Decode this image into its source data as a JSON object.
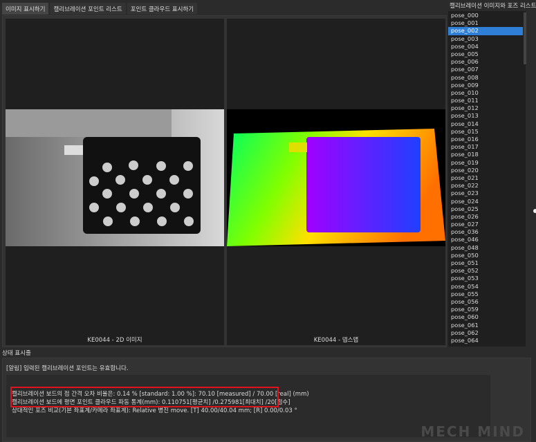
{
  "tabs": [
    "이미지 표시하기",
    "캘리브레이션 포인트 리스트",
    "포인트 클라우드 표시하기"
  ],
  "panels": {
    "left_caption": "KE0044 - 2D 이미지",
    "right_caption": "KE0044 - 뎁스맵"
  },
  "pose_list": {
    "title": "캘리브레이션 이미지와 포즈 리스트",
    "selected": "pose_002",
    "items": [
      "pose_000",
      "pose_001",
      "pose_002",
      "pose_003",
      "pose_004",
      "pose_005",
      "pose_006",
      "pose_007",
      "pose_008",
      "pose_009",
      "pose_010",
      "pose_011",
      "pose_012",
      "pose_013",
      "pose_014",
      "pose_015",
      "pose_016",
      "pose_017",
      "pose_018",
      "pose_019",
      "pose_020",
      "pose_021",
      "pose_022",
      "pose_023",
      "pose_024",
      "pose_025",
      "pose_026",
      "pose_027",
      "pose_036",
      "pose_046",
      "pose_048",
      "pose_050",
      "pose_051",
      "pose_052",
      "pose_053",
      "pose_054",
      "pose_055",
      "pose_056",
      "pose_059",
      "pose_060",
      "pose_061",
      "pose_062",
      "pose_064"
    ]
  },
  "status": {
    "label": "상태 표시줄",
    "alert": "[알림] 입력된 캘리브레이션 포인트는 유효합니다.",
    "lines": [
      "캘리브레이션 보드의 점 간격 오차 비율은: 0.14 % [standard: 1.00 %]: 70.10 [measured] / 70.00 [real] (mm)",
      "캘리브레이션 보드에 평면 포인트 클라우드 파동 통계(mm): 0.110751[평균치] /0.275981[최대치] /20[점수]",
      "상대적인 포즈 비교(기본 좌표계/카메라 좌표계): Relative 병진 move. [T] 40.00/40.04 mm; [R] 0.00/0.03 °"
    ]
  },
  "watermark": "MECH MIND"
}
